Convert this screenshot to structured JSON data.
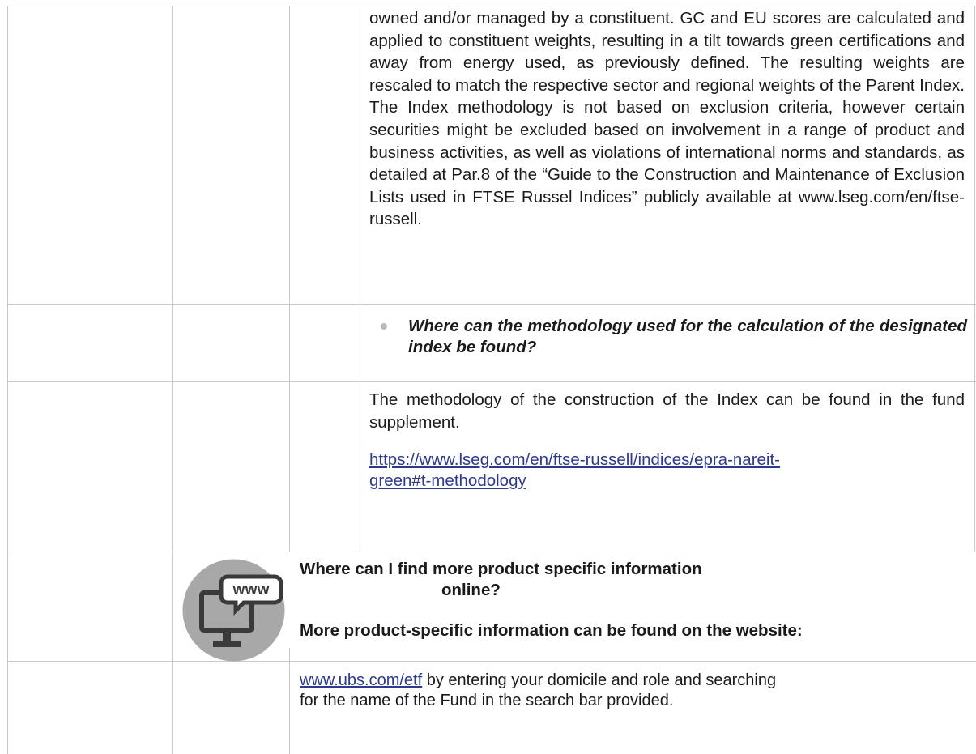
{
  "row1": {
    "text": "owned and/or managed by a constituent. GC and EU scores are calculated and applied to constituent weights, resulting in a tilt towards green certifications and away from energy used, as previously defined. The resulting weights are rescaled to match the respective sector and regional weights of the Parent Index. The Index methodology is not based on exclusion criteria, however certain securities might be excluded based on involvement in a range of product and business activities, as well as violations of international norms and standards, as detailed at Par.8 of the “Guide to the Construction and Maintenance of Exclusion Lists used in FTSE Russel Indices” publicly available at www.lseg.com/en/ftse-russell."
  },
  "row2": {
    "question": "Where can the methodology used for the calculation of the designated index be found?"
  },
  "row3": {
    "text": "The methodology of the construction of the Index can be found in the fund supplement.",
    "link_line1": "https://www.lseg.com/en/ftse-russell/indices/epra-nareit-",
    "link_line2": "green#t-methodology"
  },
  "row4": {
    "icon_name": "www-monitor-icon",
    "icon_label": "WWW",
    "heading_line1": "Where can I find more product specific information",
    "heading_line2": "online?",
    "subheading": "More product-specific information can be found on the website:"
  },
  "row5": {
    "link": "www.ubs.com/etf",
    "text_line1": " by entering your domicile and role and searching",
    "text_line2": "for the name of the Fund in the search bar provided."
  },
  "colors": {
    "border": "#c8c8c8",
    "link": "#2d3a8c",
    "icon_circle": "#a8a8a8",
    "icon_dark": "#3a3a3a"
  }
}
